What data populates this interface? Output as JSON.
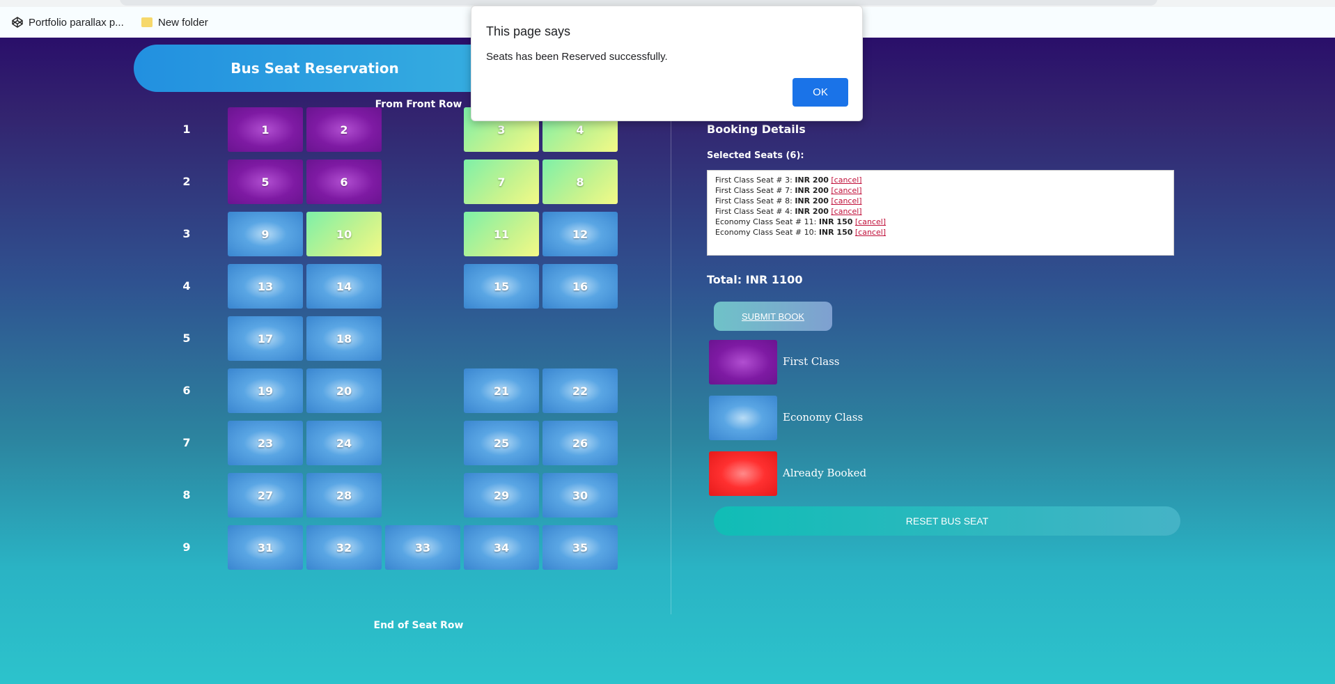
{
  "bookmarks": [
    {
      "label": "Portfolio parallax p...",
      "icon": "codepen-icon"
    },
    {
      "label": "New folder",
      "icon": "folder-icon"
    }
  ],
  "page": {
    "title": "Bus Seat Reservation",
    "front_row_label": "From Front Row",
    "end_row_label": "End of Seat Row",
    "row_labels": [
      "1",
      "2",
      "3",
      "4",
      "5",
      "6",
      "7",
      "8",
      "9"
    ],
    "seats": [
      {
        "n": "1",
        "cls": "first"
      },
      {
        "n": "2",
        "cls": "first"
      },
      {
        "n": "3",
        "cls": "selected"
      },
      {
        "n": "4",
        "cls": "selected"
      },
      {
        "n": "5",
        "cls": "first"
      },
      {
        "n": "6",
        "cls": "first"
      },
      {
        "n": "7",
        "cls": "selected"
      },
      {
        "n": "8",
        "cls": "selected"
      },
      {
        "n": "9",
        "cls": "economy"
      },
      {
        "n": "10",
        "cls": "selected"
      },
      {
        "n": "11",
        "cls": "selected"
      },
      {
        "n": "12",
        "cls": "economy"
      },
      {
        "n": "13",
        "cls": "economy"
      },
      {
        "n": "14",
        "cls": "economy"
      },
      {
        "n": "15",
        "cls": "economy"
      },
      {
        "n": "16",
        "cls": "economy"
      },
      {
        "n": "17",
        "cls": "economy"
      },
      {
        "n": "18",
        "cls": "economy"
      },
      {
        "n": "19",
        "cls": "economy"
      },
      {
        "n": "20",
        "cls": "economy"
      },
      {
        "n": "21",
        "cls": "economy"
      },
      {
        "n": "22",
        "cls": "economy"
      },
      {
        "n": "23",
        "cls": "economy"
      },
      {
        "n": "24",
        "cls": "economy"
      },
      {
        "n": "25",
        "cls": "economy"
      },
      {
        "n": "26",
        "cls": "economy"
      },
      {
        "n": "27",
        "cls": "economy"
      },
      {
        "n": "28",
        "cls": "economy"
      },
      {
        "n": "29",
        "cls": "economy"
      },
      {
        "n": "30",
        "cls": "economy"
      },
      {
        "n": "31",
        "cls": "economy"
      },
      {
        "n": "32",
        "cls": "economy"
      },
      {
        "n": "33",
        "cls": "economy"
      },
      {
        "n": "34",
        "cls": "economy"
      },
      {
        "n": "35",
        "cls": "economy"
      }
    ]
  },
  "booking": {
    "title": "Booking Details",
    "selected_title": "Selected Seats (6):",
    "items": [
      {
        "label": "First Class Seat # 3:",
        "price": "INR 200",
        "cancel": "[cancel]"
      },
      {
        "label": "First Class Seat # 7:",
        "price": "INR 200",
        "cancel": "[cancel]"
      },
      {
        "label": "First Class Seat # 8:",
        "price": "INR 200",
        "cancel": "[cancel]"
      },
      {
        "label": "First Class Seat # 4:",
        "price": "INR 200",
        "cancel": "[cancel]"
      },
      {
        "label": "Economy Class Seat # 11:",
        "price": "INR 150",
        "cancel": "[cancel]"
      },
      {
        "label": "Economy Class Seat # 10:",
        "price": "INR 150",
        "cancel": "[cancel]"
      }
    ],
    "total": "Total: INR 1100",
    "submit_label": "SUBMIT BOOK",
    "legend": [
      {
        "label": "First Class",
        "cls": "first"
      },
      {
        "label": "Economy Class",
        "cls": "economy"
      },
      {
        "label": "Already Booked",
        "cls": "booked"
      }
    ],
    "reset_label": "RESET BUS SEAT"
  },
  "alert": {
    "title": "This page says",
    "message": "Seats has been Reserved successfully.",
    "ok_label": "OK"
  }
}
